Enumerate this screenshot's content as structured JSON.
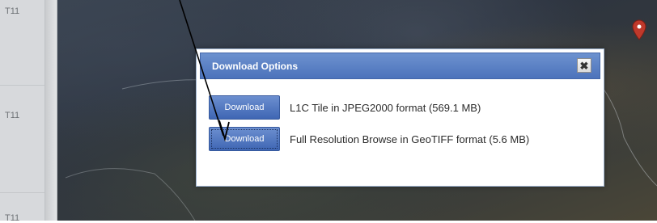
{
  "left_panel": {
    "row_labels": [
      "T11",
      "T11",
      "T11"
    ]
  },
  "dialog": {
    "title": "Download Options",
    "close_symbol": "✖",
    "options": [
      {
        "button_label": "Download",
        "description": "L1C Tile in JPEG2000 format (569.1 MB)"
      },
      {
        "button_label": "Download",
        "description": "Full Resolution Browse in GeoTIFF format (5.6 MB)"
      }
    ]
  },
  "icons": {
    "map_marker": "map-marker-icon",
    "close": "close-icon",
    "annotation_arrow": "annotation-arrow"
  },
  "colors": {
    "header_blue": "#4c73bb",
    "button_blue": "#3f66b4",
    "marker_red": "#c0392b"
  }
}
